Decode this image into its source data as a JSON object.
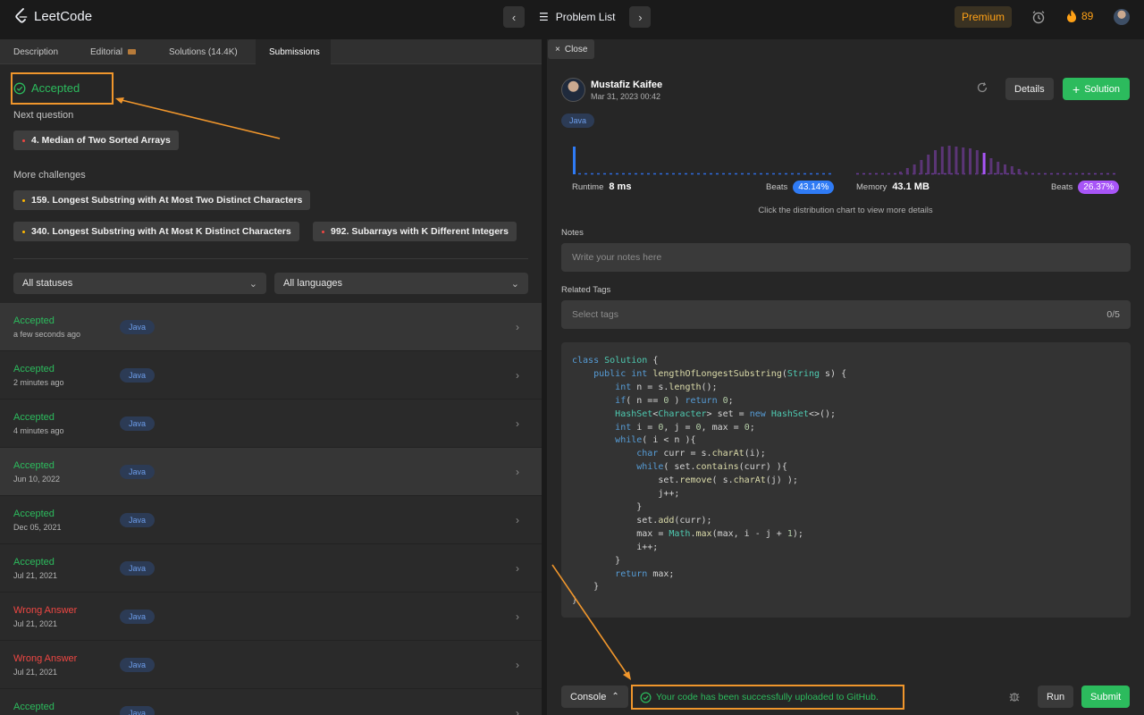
{
  "app": {
    "name": "LeetCode"
  },
  "topbar": {
    "problem_list_label": "Problem List",
    "premium_label": "Premium",
    "streak_count": "89"
  },
  "left": {
    "tabs": [
      {
        "label": "Description"
      },
      {
        "label": "Editorial"
      },
      {
        "label": "Solutions (14.4K)"
      },
      {
        "label": "Submissions"
      }
    ],
    "result_status": "Accepted",
    "next_question_label": "Next question",
    "next_question": {
      "label": "4. Median of Two Sorted Arrays",
      "difficulty_color": "#ef4743"
    },
    "more_challenges_label": "More challenges",
    "challenges": [
      {
        "label": "159. Longest Substring with At Most Two Distinct Characters",
        "difficulty_color": "#ffb800"
      },
      {
        "label": "340. Longest Substring with At Most K Distinct Characters",
        "difficulty_color": "#ffb800"
      },
      {
        "label": "992. Subarrays with K Different Integers",
        "difficulty_color": "#ef4743"
      }
    ],
    "filters": {
      "status": "All statuses",
      "language": "All languages"
    },
    "submissions": [
      {
        "status": "Accepted",
        "time": "a few seconds ago",
        "lang": "Java"
      },
      {
        "status": "Accepted",
        "time": "2 minutes ago",
        "lang": "Java"
      },
      {
        "status": "Accepted",
        "time": "4 minutes ago",
        "lang": "Java"
      },
      {
        "status": "Accepted",
        "time": "Jun 10, 2022",
        "lang": "Java"
      },
      {
        "status": "Accepted",
        "time": "Dec 05, 2021",
        "lang": "Java"
      },
      {
        "status": "Accepted",
        "time": "Jul 21, 2021",
        "lang": "Java"
      },
      {
        "status": "Wrong Answer",
        "time": "Jul 21, 2021",
        "lang": "Java"
      },
      {
        "status": "Wrong Answer",
        "time": "Jul 21, 2021",
        "lang": "Java"
      },
      {
        "status": "Accepted",
        "time": "",
        "lang": "Java"
      }
    ]
  },
  "right": {
    "close_label": "Close",
    "author": {
      "name": "Mustafiz Kaifee",
      "date": "Mar 31, 2023 00:42"
    },
    "details_label": "Details",
    "solution_label": "Solution",
    "language": "Java",
    "runtime": {
      "label": "Runtime",
      "value": "8 ms",
      "beats_label": "Beats",
      "beats": "43.14%",
      "color": "#2f7bf5"
    },
    "memory": {
      "label": "Memory",
      "value": "43.1 MB",
      "beats_label": "Beats",
      "beats": "26.37%",
      "color": "#a855f7"
    },
    "chart_hint": "Click the distribution chart to view more details",
    "notes_label": "Notes",
    "notes_placeholder": "Write your notes here",
    "tags_label": "Related Tags",
    "tags_placeholder": "Select tags",
    "tags_count": "0/5",
    "code_lines": [
      "class Solution {",
      "    public int lengthOfLongestSubstring(String s) {",
      "        int n = s.length();",
      "        if( n == 0 ) return 0;",
      "        HashSet<Character> set = new HashSet<>();",
      "        int i = 0, j = 0, max = 0;",
      "        while( i < n ){",
      "            char curr = s.charAt(i);",
      "            while( set.contains(curr) ){",
      "                set.remove( s.charAt(j) );",
      "                j++;",
      "            }",
      "            set.add(curr);",
      "            max = Math.max(max, i - j + 1);",
      "            i++;",
      "        }",
      "        return max;",
      "    }",
      "}"
    ],
    "console_label": "Console",
    "upload_message": "Your code has been successfully uploaded to GitHub.",
    "run_label": "Run",
    "submit_label": "Submit"
  }
}
